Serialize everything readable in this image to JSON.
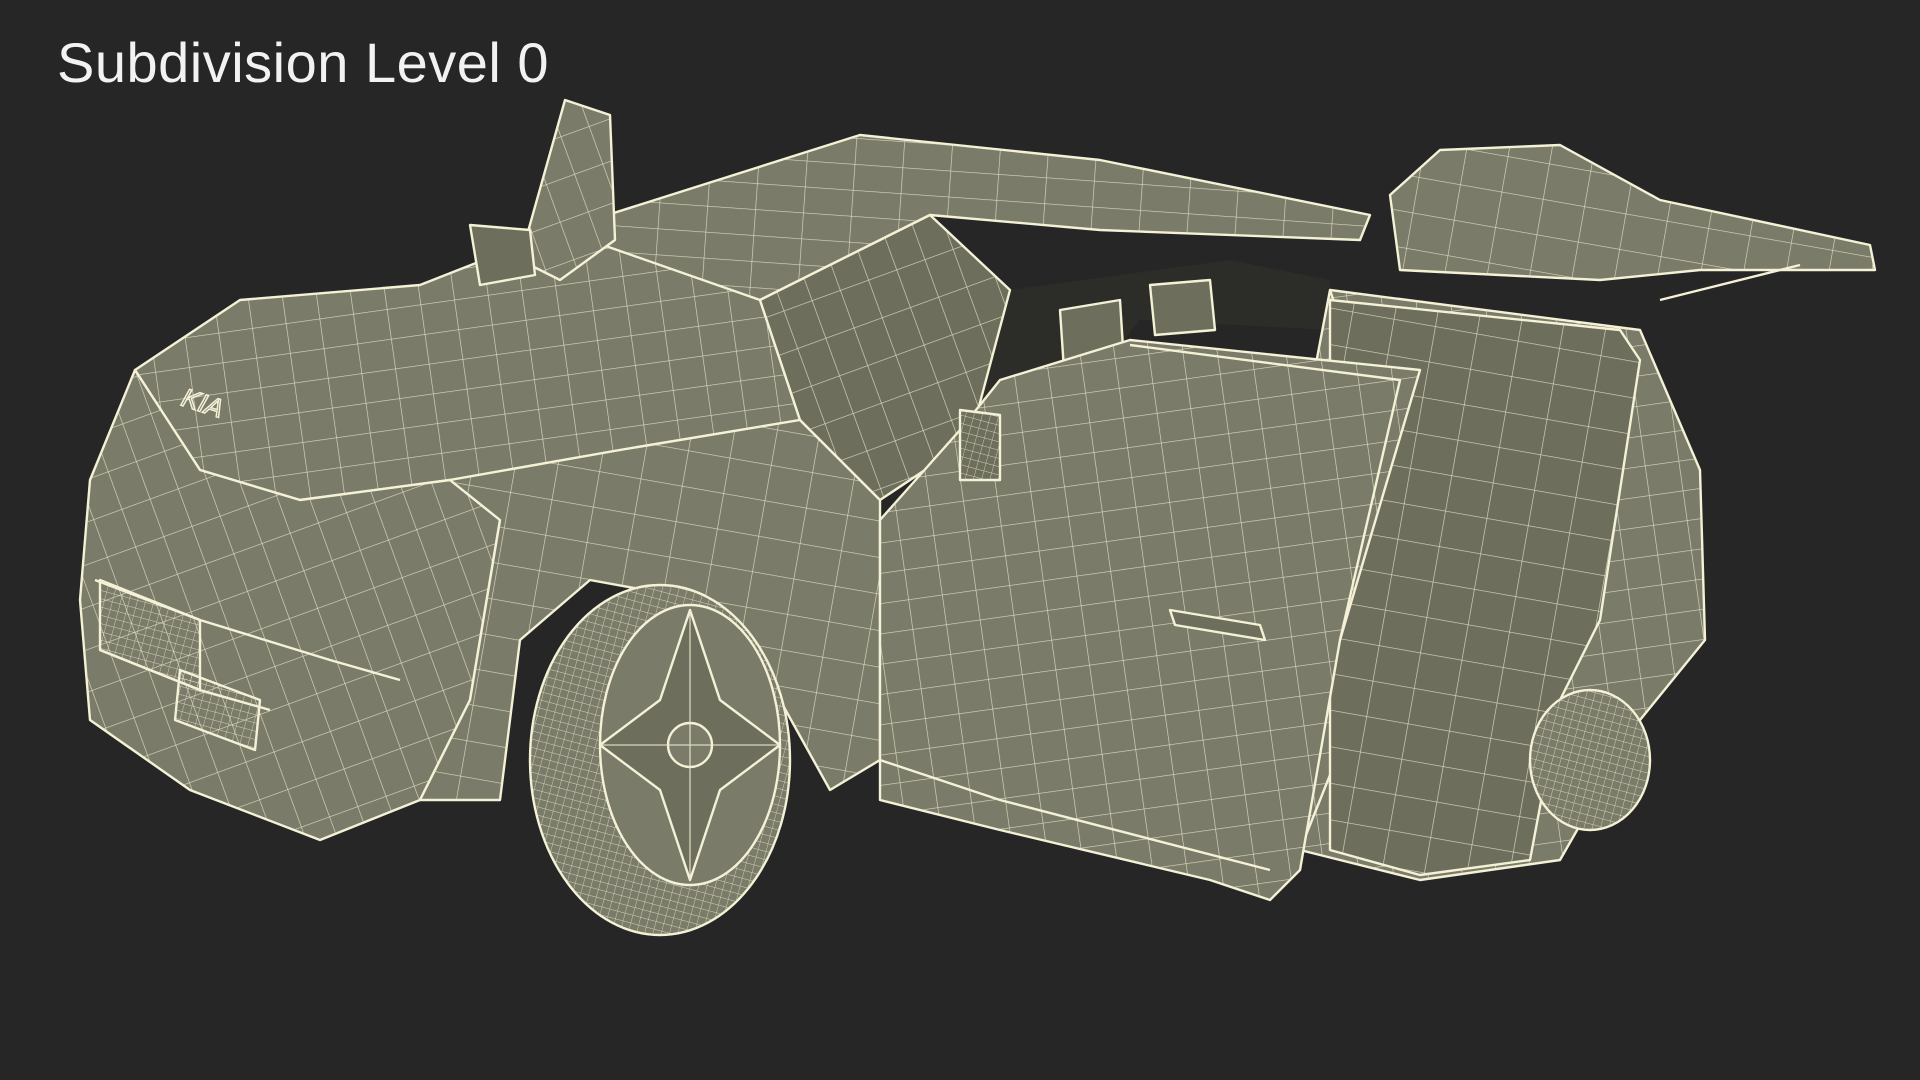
{
  "viewport": {
    "caption": "Subdivision Level 0",
    "background_color": "#262626",
    "mesh_fill_color": "#7a7b68",
    "mesh_fill_dark_color": "#6d6e5c",
    "wire_color": "#f4f1d6",
    "subject": "car-wireframe-render"
  }
}
